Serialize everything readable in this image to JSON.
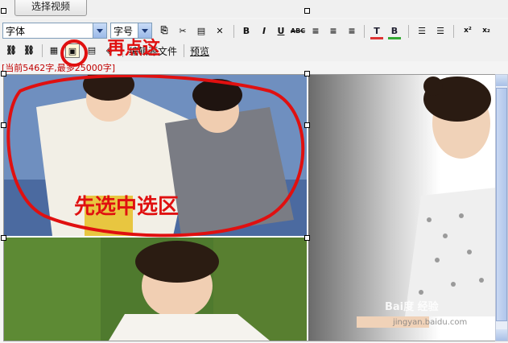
{
  "top": {
    "select_video_label": "选择视频"
  },
  "toolbar": {
    "font_combo": "字体",
    "size_combo": "字号",
    "row1_buttons": [
      {
        "name": "copy-icon",
        "glyph": "⎘"
      },
      {
        "name": "cut-icon",
        "glyph": "✂"
      },
      {
        "name": "paste-icon",
        "glyph": "📋"
      },
      {
        "name": "delete-icon",
        "glyph": "✕"
      },
      {
        "name": "bold-button",
        "glyph": "B"
      },
      {
        "name": "italic-button",
        "glyph": "I"
      },
      {
        "name": "underline-button",
        "glyph": "U"
      },
      {
        "name": "strikethrough-button",
        "glyph": "ABC"
      },
      {
        "name": "align-left-icon",
        "glyph": "≡"
      },
      {
        "name": "align-center-icon",
        "glyph": "≡"
      },
      {
        "name": "align-right-icon",
        "glyph": "≡"
      },
      {
        "name": "text-color-icon",
        "glyph": "T"
      },
      {
        "name": "bg-color-icon",
        "glyph": "B"
      },
      {
        "name": "ordered-list-icon",
        "glyph": "☰"
      },
      {
        "name": "unordered-list-icon",
        "glyph": "☰"
      },
      {
        "name": "superscript-icon",
        "glyph": "x²"
      },
      {
        "name": "subscript-icon",
        "glyph": "x₂"
      }
    ],
    "source_label": "编辑源文件",
    "preview_label": "预览"
  },
  "counter_text": "[当前5462字,最多25000字]",
  "annotations": {
    "click_again": "再点这",
    "select_area": "先选中选区"
  },
  "watermark": "Bai度 经验",
  "watermark_sub": "jingyan.baidu.com",
  "colors": {
    "annotation_red": "#e01010",
    "counter_red": "#c00000"
  }
}
